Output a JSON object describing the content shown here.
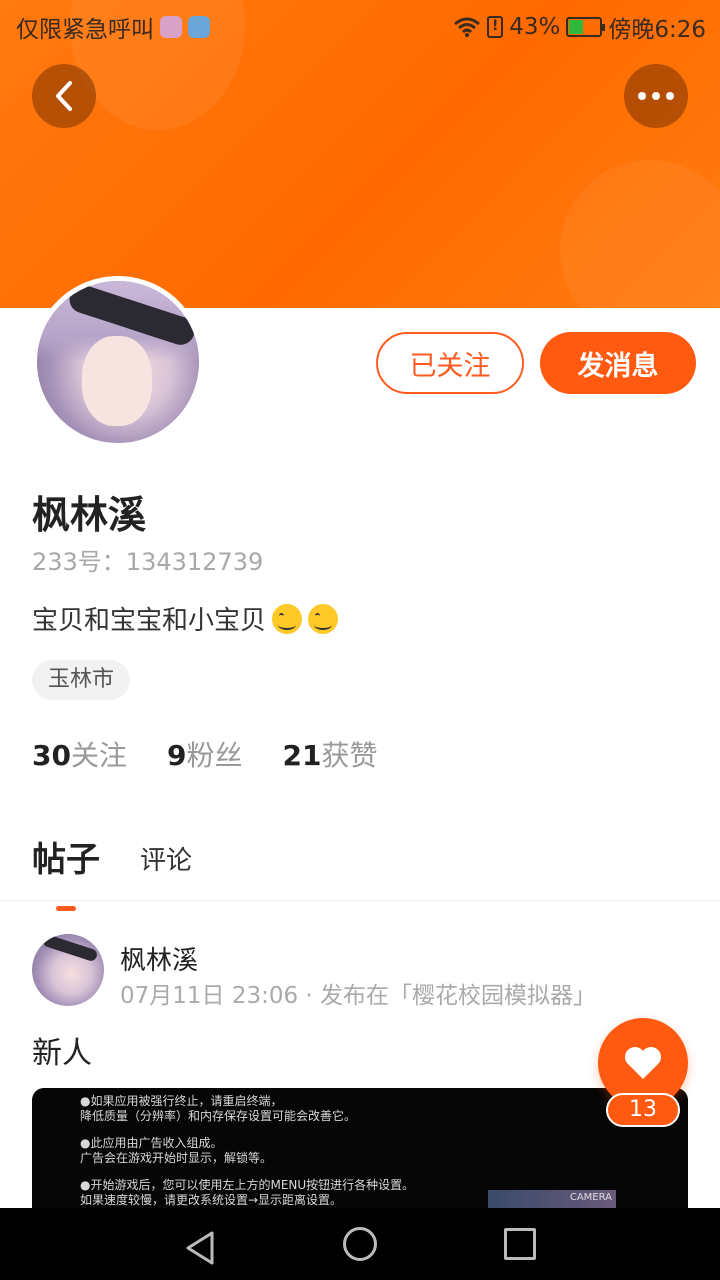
{
  "status_bar": {
    "carrier": "仅限紧急呼叫",
    "battery_percent": "43%",
    "time": "傍晚6:26",
    "battery_level": 0.43
  },
  "header": {
    "back_icon": "chevron-left-icon",
    "more_icon": "more-horizontal-icon",
    "banner_color": "#ff6a00"
  },
  "profile": {
    "follow_label": "已关注",
    "message_label": "发消息",
    "name": "枫林溪",
    "id_text": "233号：134312739",
    "bio": "宝贝和宝宝和小宝贝",
    "location_tag": "玉林市",
    "stats": [
      {
        "num": "30",
        "label": "关注"
      },
      {
        "num": "9",
        "label": "粉丝"
      },
      {
        "num": "21",
        "label": "获赞"
      }
    ]
  },
  "tabs": [
    {
      "label": "帖子",
      "active": true
    },
    {
      "label": "评论",
      "active": false
    }
  ],
  "post": {
    "author": "枫林溪",
    "meta": "07月11日 23:06 · 发布在「樱花校园模拟器」",
    "text": "新人",
    "image_lines": [
      "●如果应用被强行终止，请重启终端，",
      "降低质量（分辨率）和内存保存设置可能会改善它。",
      "●此应用由广告收入组成。",
      "广告会在游戏开始时显示，解锁等。",
      "●开始游戏后，您可以使用左上方的MENU按钮进行各种设置。",
      "如果速度较慢，请更改系统设置→显示距离设置。"
    ],
    "image_thumb_label": "CAMERA",
    "like_count": "13"
  },
  "accent_color": "#ff5a10"
}
